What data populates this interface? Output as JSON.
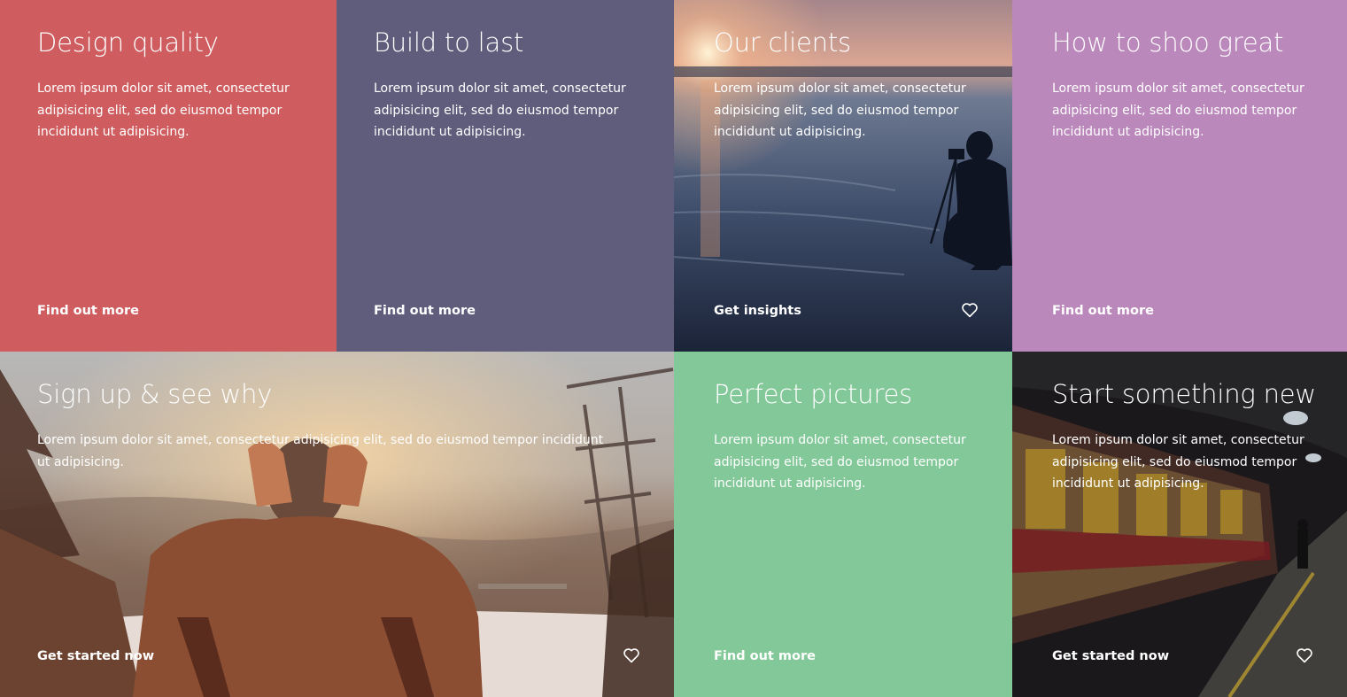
{
  "tiles": [
    {
      "title": "Design quality",
      "body": "Lorem ipsum dolor sit amet, consectetur adipisicing elit, sed do eiusmod tempor incididunt ut adipisicing.",
      "cta": "Find out more",
      "color": "#cf5d5f"
    },
    {
      "title": "Build to last",
      "body": "Lorem ipsum dolor sit amet, consectetur adipisicing elit, sed do eiusmod tempor incididunt ut adipisicing.",
      "cta": "Find out more",
      "color": "#5f5c7c"
    },
    {
      "title": "Our clients",
      "body": "Lorem ipsum dolor sit amet, consectetur adipisicing elit, sed do eiusmod tempor incididunt ut adipisicing.",
      "cta": "Get insights",
      "icon": "heart-icon"
    },
    {
      "title": "How to shoo great",
      "body": "Lorem ipsum dolor sit amet, consectetur adipisicing elit, sed do eiusmod tempor incididunt ut adipisicing.",
      "cta": "Find out more",
      "color": "#bb88bb"
    },
    {
      "title": "Sign up & see why",
      "body": "Lorem ipsum dolor sit amet, consectetur adipisicing elit, sed do eiusmod tempor incididunt ut adipisicing.",
      "cta": "Get started now",
      "icon": "heart-icon"
    },
    {
      "title": "Perfect pictures",
      "body": "Lorem ipsum dolor sit amet, consectetur adipisicing elit, sed do eiusmod tempor incididunt ut adipisicing.",
      "cta": "Find out more",
      "color": "#82c898"
    },
    {
      "title": "Start something new",
      "body": "Lorem ipsum dolor sit amet, consectetur adipisicing elit, sed do eiusmod tempor incididunt ut adipisicing.",
      "cta": "Get started now",
      "icon": "heart-icon"
    }
  ]
}
